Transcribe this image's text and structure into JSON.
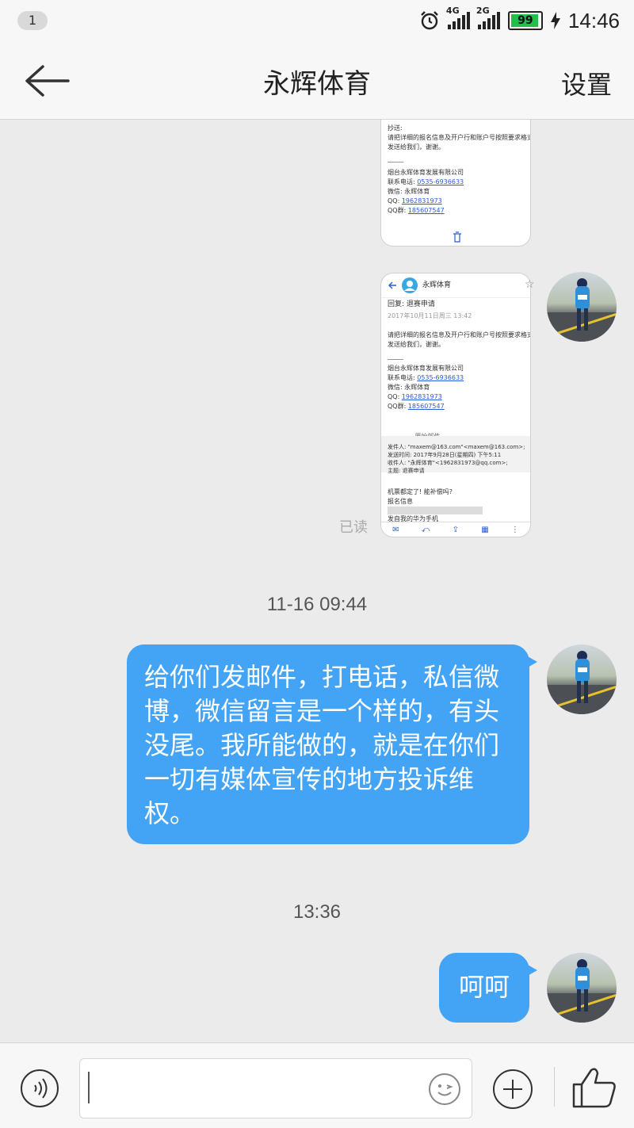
{
  "status_bar": {
    "notification_count": "1",
    "network_1": "4G",
    "network_2": "2G",
    "battery": "99",
    "time": "14:46"
  },
  "header": {
    "title": "永辉体育",
    "settings_label": "设置"
  },
  "messages": {
    "read_status": "已读",
    "timestamp_1": "11-16 09:44",
    "text_1": "给你们发邮件，打电话，私信微博，微信留言是一个样的，有头没尾。我所能做的，就是在你们一切有媒体宣传的地方投诉维权。",
    "timestamp_2": "13:36",
    "text_2": "呵呵"
  },
  "image_1": {
    "cc": "抄送:",
    "body_1": "请把详细的报名信息及开户行和账户号按照要求格式",
    "body_2": "发送给我们，谢谢。",
    "company": "烟台永辉体育发展有限公司",
    "phone_label": "联系电话: ",
    "phone": "0535-6936633",
    "wechat": "微信: 永辉体育",
    "qq_label": "QQ: ",
    "qq": "1962831973",
    "qq_group_label": "QQ群: ",
    "qq_group": "185607547"
  },
  "image_2": {
    "sender": "永辉体育",
    "subject": "回复: 退赛申请",
    "date": "2017年10月11日周三 13:42",
    "body_1": "请把详细的报名信息及开户行和账户号按照要求格式",
    "body_2": "发送给我们，谢谢。",
    "company": "烟台永辉体育发展有限公司",
    "phone_label": "联系电话: ",
    "phone": "0535-6936633",
    "wechat": "微信: 永辉体育",
    "qq_label": "QQ: ",
    "qq": "1962831973",
    "qq_group_label": "QQ群: ",
    "qq_group": "185607547",
    "original_divider": "———— 原始邮件 ————",
    "from": "发件人: \"maxem@163.com\"<maxem@163.com>;",
    "sent": "发送时间: 2017年9月28日(星期四) 下午5:11",
    "to": "收件人: \"永辉体育\"<1962831973@qq.com>;",
    "subject_orig": "主题: 退赛申请",
    "reply_1": "机票都定了! 能补偿吗?",
    "reply_2": "报名信息",
    "footer": "发自我的华为手机"
  }
}
